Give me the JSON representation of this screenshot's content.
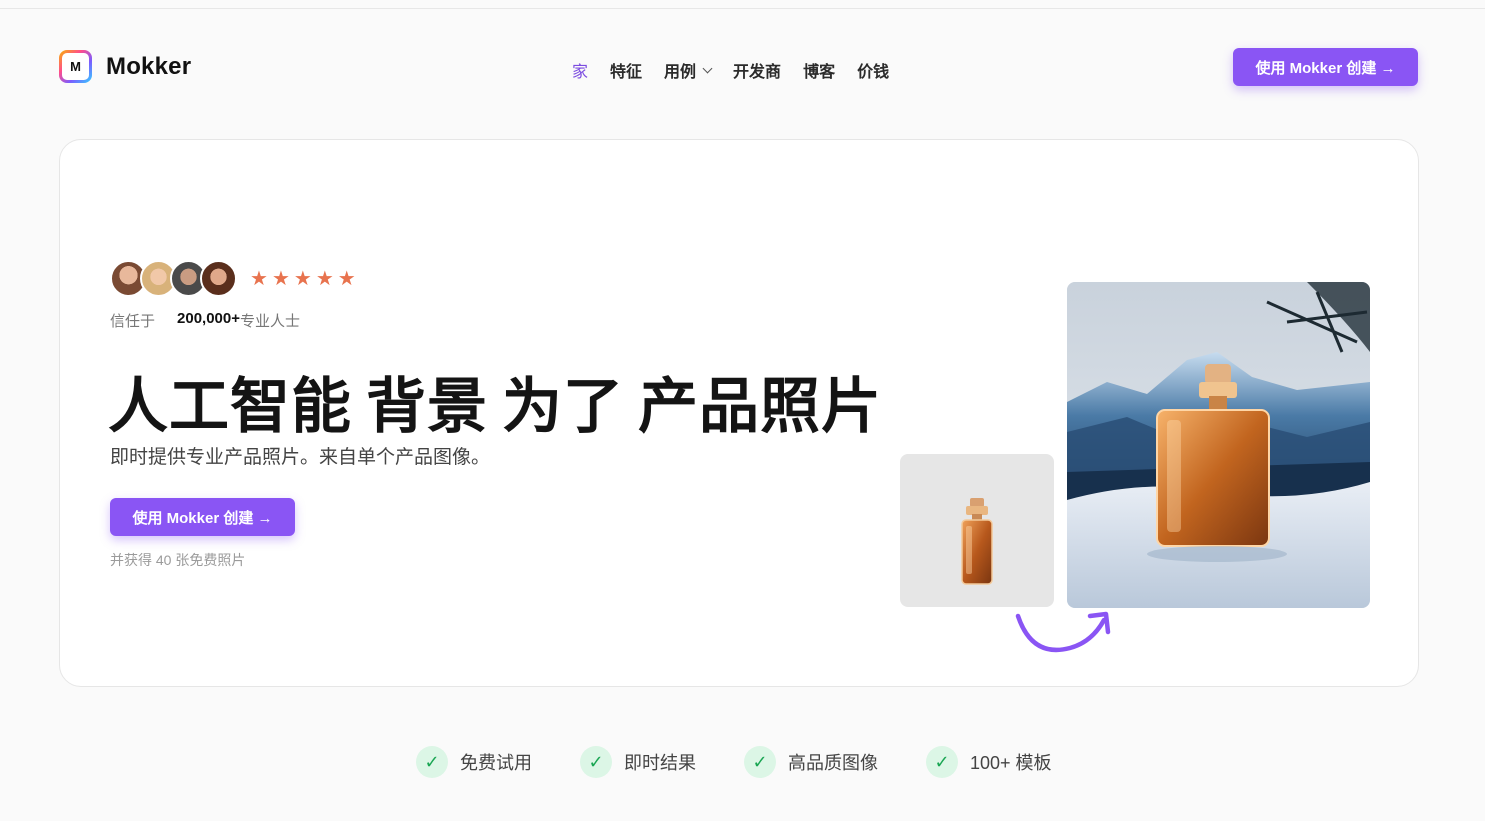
{
  "brand": {
    "logo_letter": "M",
    "name": "Mokker"
  },
  "nav": {
    "items": [
      {
        "label": "家",
        "active": true
      },
      {
        "label": "特征"
      },
      {
        "label": "用例",
        "dropdown": true
      },
      {
        "label": "开发商"
      },
      {
        "label": "博客"
      },
      {
        "label": "价钱"
      }
    ]
  },
  "header": {
    "cta_label": "使用 Mokker 创建 →"
  },
  "hero": {
    "rating_stars": 5,
    "trusted_prefix": "信任于",
    "trusted_count": "200,000+",
    "trusted_suffix": "专业人士",
    "headline": [
      "人工智能",
      "背景",
      "为了"
    ],
    "headline_highlight": "产品照片",
    "subtitle": "即时提供专业产品照片。来自单个产品图像。",
    "cta_label": "使用 Mokker 创建 →",
    "free_note": "并获得 40 张免费照片"
  },
  "features": [
    {
      "label": "免费试用"
    },
    {
      "label": "即时结果"
    },
    {
      "label": "高品质图像"
    },
    {
      "label": "100+ 模板"
    }
  ],
  "colors": {
    "accent": "#8a55f4",
    "star": "#e8734e",
    "check": "#1aa653"
  }
}
